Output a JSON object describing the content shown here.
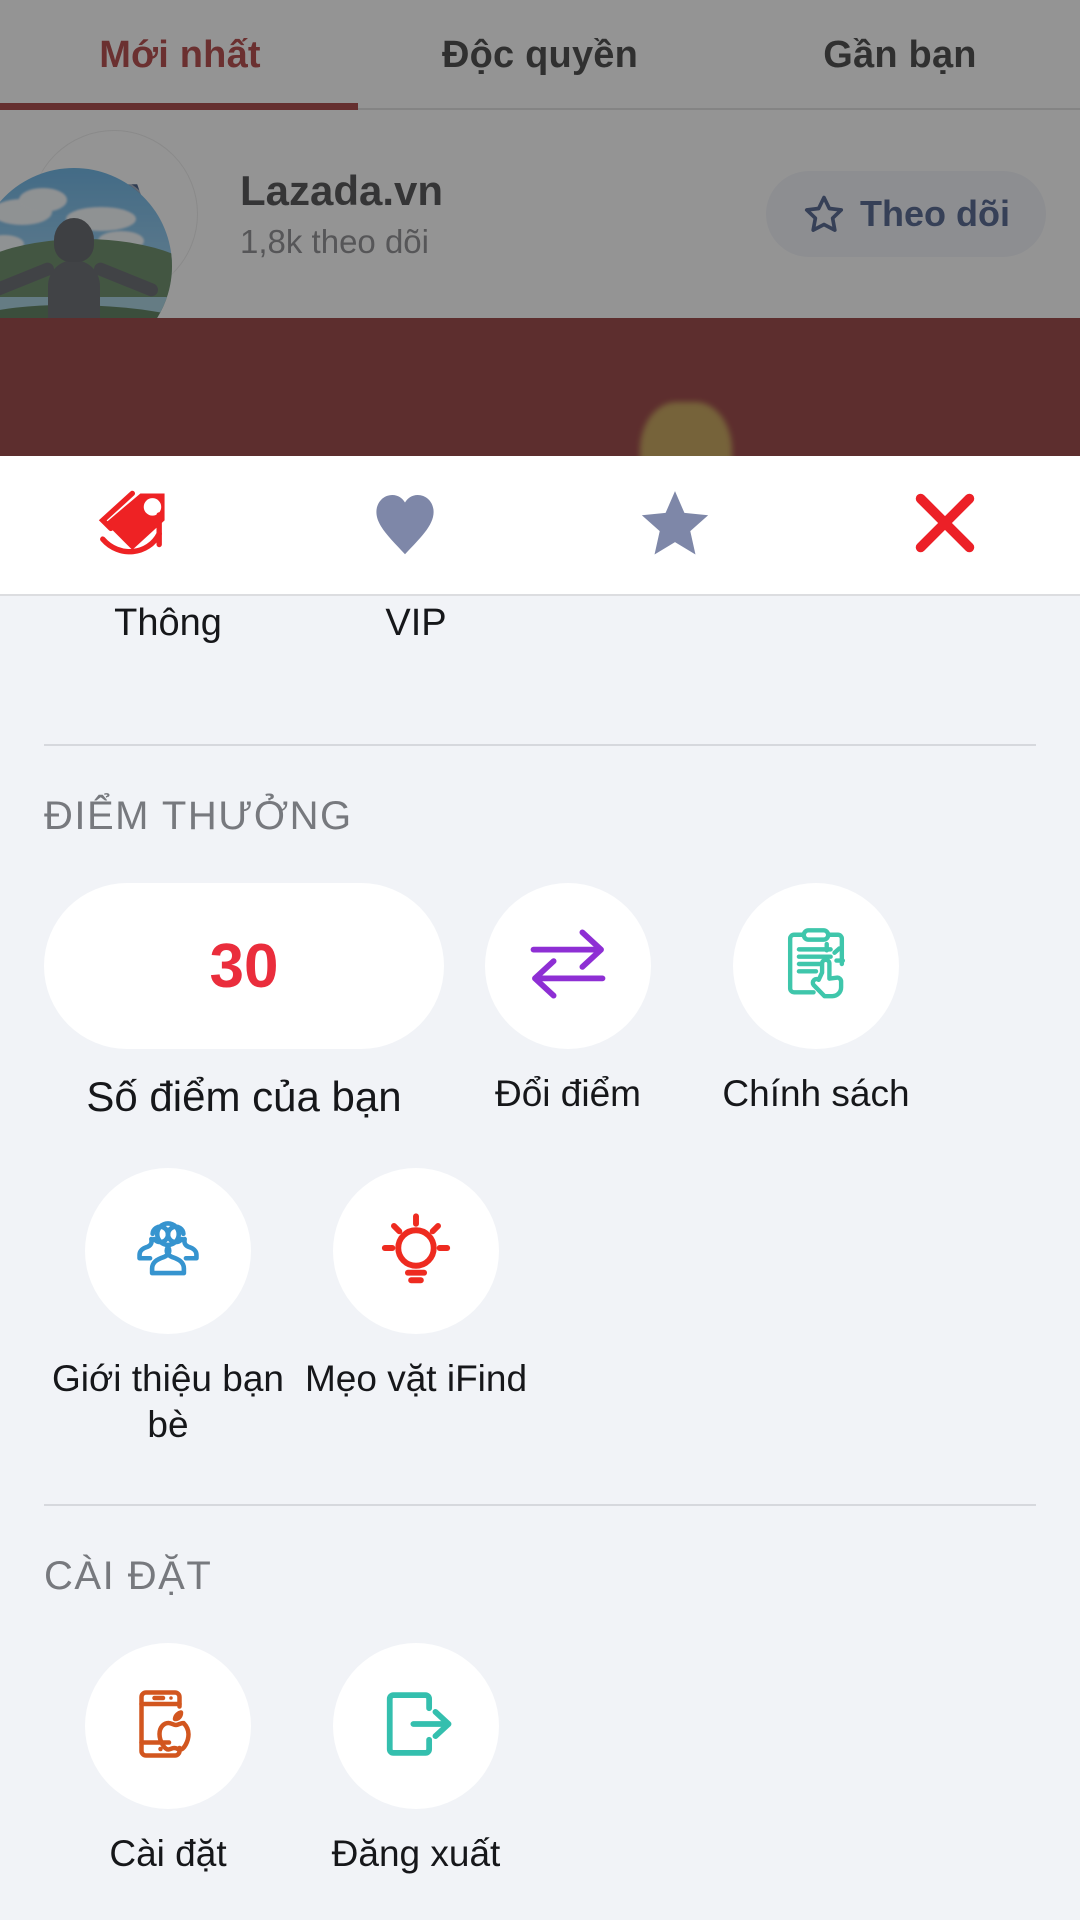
{
  "top_tabs": {
    "items": [
      {
        "label": "Mới nhất",
        "active": true
      },
      {
        "label": "Độc quyền",
        "active": false
      },
      {
        "label": "Gần bạn",
        "active": false
      }
    ],
    "active_color": "#9d1212"
  },
  "store": {
    "logo_text_main": "DA",
    "logo_text_sub": "VN",
    "name": "Lazada.vn",
    "followers": "1,8k theo dõi",
    "follow_label": "Theo dõi",
    "follow_icon": "star-outline-icon",
    "follow_color": "#20376e",
    "avatar_icon": "user-avatar-photo"
  },
  "action_sheet": {
    "items": [
      {
        "icon": "price-tag-icon",
        "color": "#ee2224"
      },
      {
        "icon": "heart-icon",
        "color": "#7e87a8"
      },
      {
        "icon": "star-icon",
        "color": "#7e87a8"
      },
      {
        "icon": "close-icon",
        "color": "#ec2027"
      }
    ]
  },
  "partial_row": {
    "items": [
      {
        "label": "Thông"
      },
      {
        "label": "VIP"
      }
    ]
  },
  "rewards": {
    "section_title": "ĐIỂM THƯỞNG",
    "points_value": "30",
    "points_label": "Số điểm của bạn",
    "points_color": "#ea2d3c",
    "items": [
      {
        "label": "Đổi điểm",
        "icon": "exchange-arrows-icon",
        "color": "#8e2fd4"
      },
      {
        "label": "Chính sách",
        "icon": "clipboard-hand-icon",
        "color": "#3fc6ab"
      },
      {
        "label": "Giới thiệu bạn bè",
        "icon": "people-group-icon",
        "color": "#3694cf"
      },
      {
        "label": "Mẹo vặt iFind",
        "icon": "lightbulb-icon",
        "color": "#ee2b20"
      }
    ]
  },
  "settings": {
    "section_title": "CÀI ĐẶT",
    "items": [
      {
        "label": "Cài đặt",
        "icon": "phone-apple-icon",
        "color": "#d2561f"
      },
      {
        "label": "Đăng xuất",
        "icon": "logout-icon",
        "color": "#34bfae"
      }
    ]
  }
}
